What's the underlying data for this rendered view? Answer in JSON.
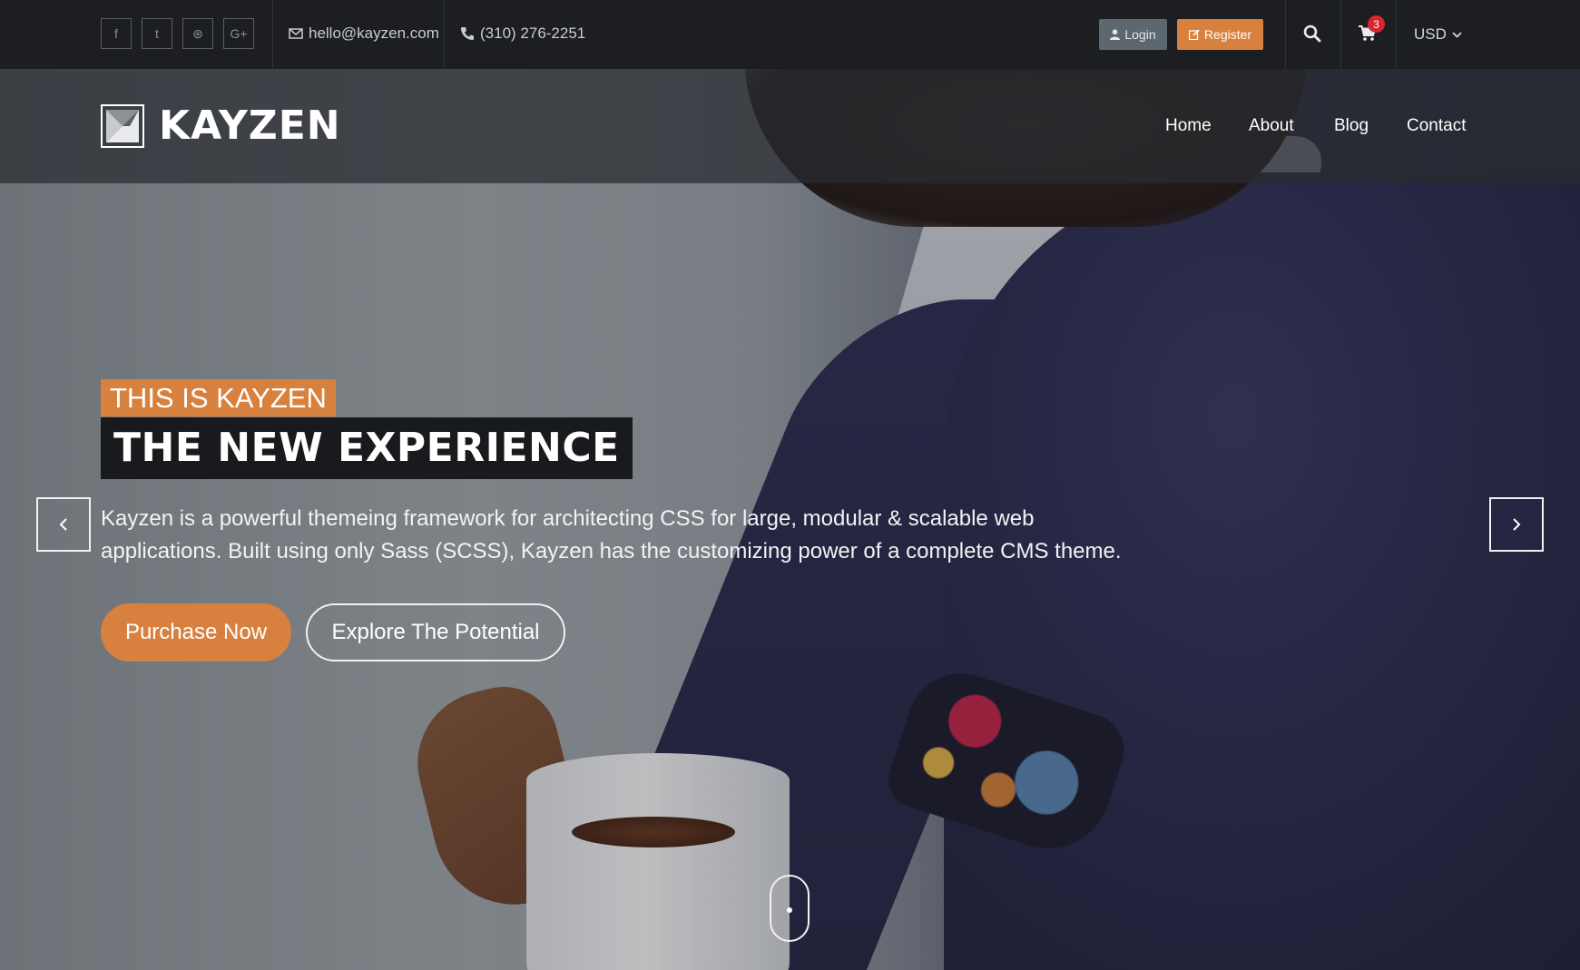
{
  "social": {
    "items": [
      {
        "icon": "facebook-icon",
        "glyph": "f"
      },
      {
        "icon": "twitter-icon",
        "glyph": "t"
      },
      {
        "icon": "dribbble-icon",
        "glyph": "⊛"
      },
      {
        "icon": "google-plus-icon",
        "glyph": "G+"
      }
    ]
  },
  "contact": {
    "email": "hello@kayzen.com",
    "phone": "(310) 276-2251"
  },
  "account": {
    "login_label": "Login",
    "register_label": "Register"
  },
  "cart": {
    "count": "3"
  },
  "currency": {
    "selected": "USD"
  },
  "brand": {
    "name": "KAYZEN"
  },
  "nav": {
    "items": [
      {
        "label": "Home"
      },
      {
        "label": "About"
      },
      {
        "label": "Blog"
      },
      {
        "label": "Contact"
      }
    ]
  },
  "hero": {
    "eyebrow": "THIS IS KAYZEN",
    "headline": "THE NEW EXPERIENCE",
    "lede": "Kayzen is a powerful themeing framework for architecting CSS for large, modular & scalable web applications. Built using only Sass (SCSS), Kayzen has the customizing power of a complete CMS theme.",
    "primary_cta": "Purchase Now",
    "secondary_cta": "Explore The Potential"
  },
  "colors": {
    "accent": "#d8813f",
    "topbar": "#1c1e21",
    "login_bg": "#5d6770",
    "badge": "#d8262f"
  }
}
